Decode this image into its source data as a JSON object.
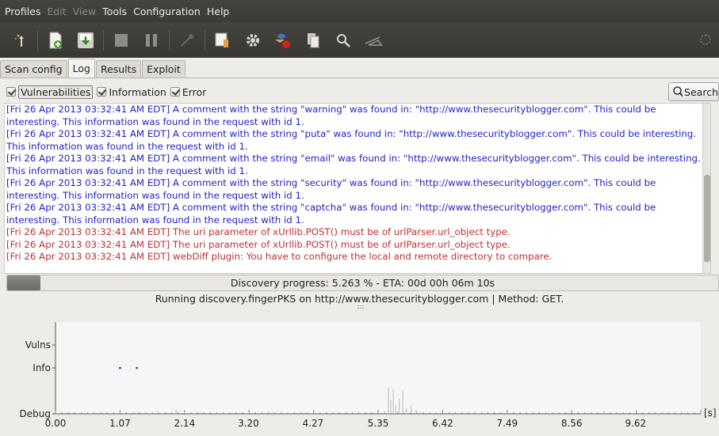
{
  "menubar": [
    "Profiles",
    "Edit",
    "View",
    "Tools",
    "Configuration",
    "Help"
  ],
  "menubar_disabled": [
    false,
    true,
    true,
    false,
    false,
    false
  ],
  "toolbar_icons": [
    "wizard-icon",
    "new-profile-icon",
    "save-profile-icon",
    "stop-icon",
    "pause-icon",
    "clear-icon",
    "manual-request-icon",
    "fuzzy-request-icon",
    "encode-decode-icon",
    "export-request-icon",
    "compare-icon",
    "proxy-icon"
  ],
  "tabs": [
    "Scan config",
    "Log",
    "Results",
    "Exploit"
  ],
  "active_tab": "Log",
  "filters": [
    {
      "label": "Vulnerabilities",
      "checked": true
    },
    {
      "label": "Information",
      "checked": true
    },
    {
      "label": "Error",
      "checked": true
    }
  ],
  "search_label": "Search",
  "log_lines": [
    {
      "text": "[Fri 26 Apr 2013 03:32:41 AM EDT] A comment with the string \"warning\" was found in: \"http://www.thesecurityblogger.com\". This could be",
      "color": "blue"
    },
    {
      "text": "interesting. This information was found in the request with id 1.",
      "color": "blue"
    },
    {
      "text": "[Fri 26 Apr 2013 03:32:41 AM EDT] A comment with the string \"puta\" was found in: \"http://www.thesecurityblogger.com\". This could be interesting.",
      "color": "blue"
    },
    {
      "text": "This information was found in the request with id 1.",
      "color": "blue"
    },
    {
      "text": "[Fri 26 Apr 2013 03:32:41 AM EDT] A comment with the string \"email\" was found in: \"http://www.thesecurityblogger.com\". This could be interesting.",
      "color": "blue"
    },
    {
      "text": "This information was found in the request with id 1.",
      "color": "blue"
    },
    {
      "text": "[Fri 26 Apr 2013 03:32:41 AM EDT] A comment with the string \"security\" was found in: \"http://www.thesecurityblogger.com\". This could be",
      "color": "blue"
    },
    {
      "text": "interesting. This information was found in the request with id 1.",
      "color": "blue"
    },
    {
      "text": "[Fri 26 Apr 2013 03:32:41 AM EDT] A comment with the string \"captcha\" was found in: \"http://www.thesecurityblogger.com\". This could be",
      "color": "blue"
    },
    {
      "text": "interesting. This information was found in the request with id 1.",
      "color": "blue"
    },
    {
      "text": "[Fri 26 Apr 2013 03:32:41 AM EDT] The uri parameter of xUrllib.POST() must be of urlParser.url_object type.",
      "color": "red"
    },
    {
      "text": "[Fri 26 Apr 2013 03:32:41 AM EDT] The uri parameter of xUrllib.POST() must be of urlParser.url_object type.",
      "color": "red"
    },
    {
      "text": "[Fri 26 Apr 2013 03:32:41 AM EDT] webDiff plugin: You have to configure the local and remote directory to compare.",
      "color": "red"
    }
  ],
  "progress": {
    "text": "Discovery progress: 5.263 % - ETA: 00d 00h 06m 10s",
    "fraction": 0.05263,
    "running": "Running discovery.fingerPKS on http://www.thesecurityblogger.com | Method: GET."
  },
  "colors": {
    "info_log": "#2222c8",
    "error_log": "#c03030",
    "chart_bg": "#f6f6f6"
  },
  "chart_data": {
    "type": "scatter",
    "y_categories": [
      "Debug",
      "Info",
      "Vulns"
    ],
    "x_ticks": [
      "0.00",
      "1.07",
      "2.14",
      "3.20",
      "4.27",
      "5.35",
      "6.42",
      "7.49",
      "8.56",
      "9.62"
    ],
    "x_unit": "[s]",
    "xlim": [
      0,
      10.7
    ],
    "info_points": [
      1.07,
      1.35
    ],
    "debug_spikes": [
      [
        2.0,
        0.15
      ],
      [
        2.4,
        0.05
      ],
      [
        3.6,
        0.05
      ],
      [
        5.45,
        0.1
      ],
      [
        5.52,
        0.95
      ],
      [
        5.56,
        0.5
      ],
      [
        5.6,
        0.9
      ],
      [
        5.64,
        0.3
      ],
      [
        5.7,
        0.55
      ],
      [
        5.76,
        0.85
      ],
      [
        5.82,
        0.2
      ],
      [
        5.9,
        0.3
      ],
      [
        5.98,
        0.15
      ],
      [
        6.05,
        0.05
      ],
      [
        9.1,
        0.1
      ]
    ]
  }
}
